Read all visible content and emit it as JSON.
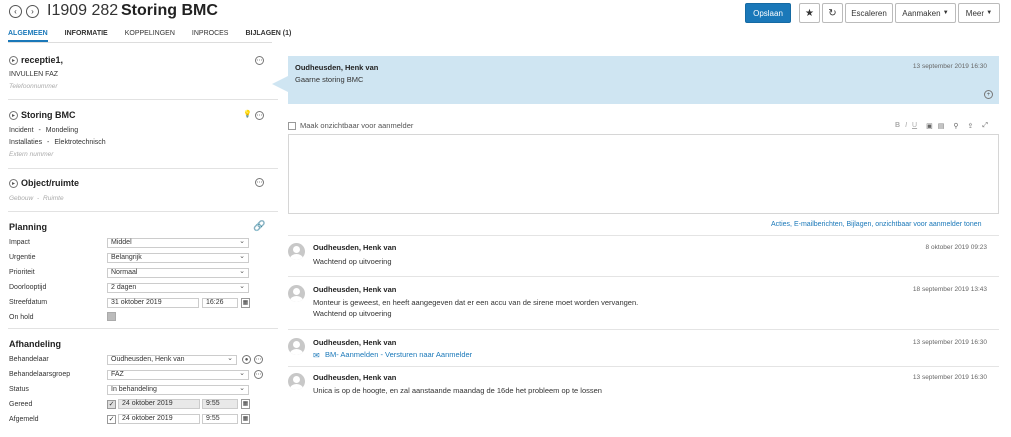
{
  "header": {
    "id": "I1909 282",
    "title": "Storing BMC",
    "back_icon": "‹",
    "forward_icon": "›"
  },
  "toolbar": {
    "save": "Opslaan",
    "star_icon": "★",
    "refresh_icon": "↻",
    "escalate": "Escaleren",
    "create": "Aanmaken",
    "more": "Meer"
  },
  "tabs": [
    "ALGEMEEN",
    "INFORMATIE",
    "KOPPELINGEN",
    "INPROCES",
    "BIJLAGEN (1)"
  ],
  "caller": {
    "name": "receptie1,",
    "line1": "INVULLEN FAZ",
    "phone_placeholder": "Telefoonnummer"
  },
  "request": {
    "title": "Storing BMC",
    "type": "Incident",
    "sep1": "-",
    "channel": "Mondeling",
    "category": "Installaties",
    "sep2": "-",
    "subcategory": "Elektrotechnisch",
    "ext_placeholder": "Extern nummer"
  },
  "object": {
    "title": "Object/ruimte",
    "building_placeholder": "Gebouw",
    "sep": "-",
    "room_placeholder": "Ruimte"
  },
  "planning": {
    "title": "Planning",
    "fields": [
      {
        "label": "Impact",
        "value": "Middel"
      },
      {
        "label": "Urgentie",
        "value": "Belangrijk"
      },
      {
        "label": "Prioriteit",
        "value": "Normaal"
      },
      {
        "label": "Doorlooptijd",
        "value": "2 dagen"
      }
    ],
    "deadline_label": "Streefdatum",
    "deadline_date": "31 oktober 2019",
    "deadline_time": "16:26",
    "onhold_label": "On hold"
  },
  "handling": {
    "title": "Afhandeling",
    "operator_label": "Behandelaar",
    "operator_value": "Oudheusden, Henk van",
    "group_label": "Behandelaarsgroep",
    "group_value": "FAZ",
    "status_label": "Status",
    "status_value": "In behandeling",
    "done_label": "Gereed",
    "done_date": "24 oktober 2019",
    "done_time": "9:55",
    "closed_label": "Afgemeld",
    "closed_date": "24 oktober 2019",
    "closed_time": "9:55"
  },
  "top_message": {
    "author": "Oudheusden, Henk van",
    "date": "13 september 2019 16:30",
    "text": "Gaarne storing BMC"
  },
  "editor": {
    "invisible_label": "Maak onzichtbaar voor aanmelder",
    "b": "B",
    "i": "I",
    "u": "U"
  },
  "actions_link": "Acties, E-mailberichten, Bijlagen, onzichtbaar voor aanmelder tonen",
  "messages": [
    {
      "author": "Oudheusden, Henk van",
      "date": "8 oktober 2019 09:23",
      "lines": [
        "Wachtend op uitvoering"
      ]
    },
    {
      "author": "Oudheusden, Henk van",
      "date": "18 september 2019 13:43",
      "lines": [
        "Monteur is geweest, en heeft aangegeven dat er een accu van de sirene moet worden vervangen.",
        "Wachtend op uitvoering"
      ]
    },
    {
      "author": "Oudheusden, Henk van",
      "date": "13 september 2019 16:30",
      "link": "BM- Aanmelden - Versturen naar Aanmelder"
    },
    {
      "author": "Oudheusden, Henk van",
      "date": "13 september 2019 16:30",
      "lines": [
        "Unica is op de hoogte, en zal aanstaande maandag de 16de het probleem op te lossen"
      ]
    }
  ]
}
